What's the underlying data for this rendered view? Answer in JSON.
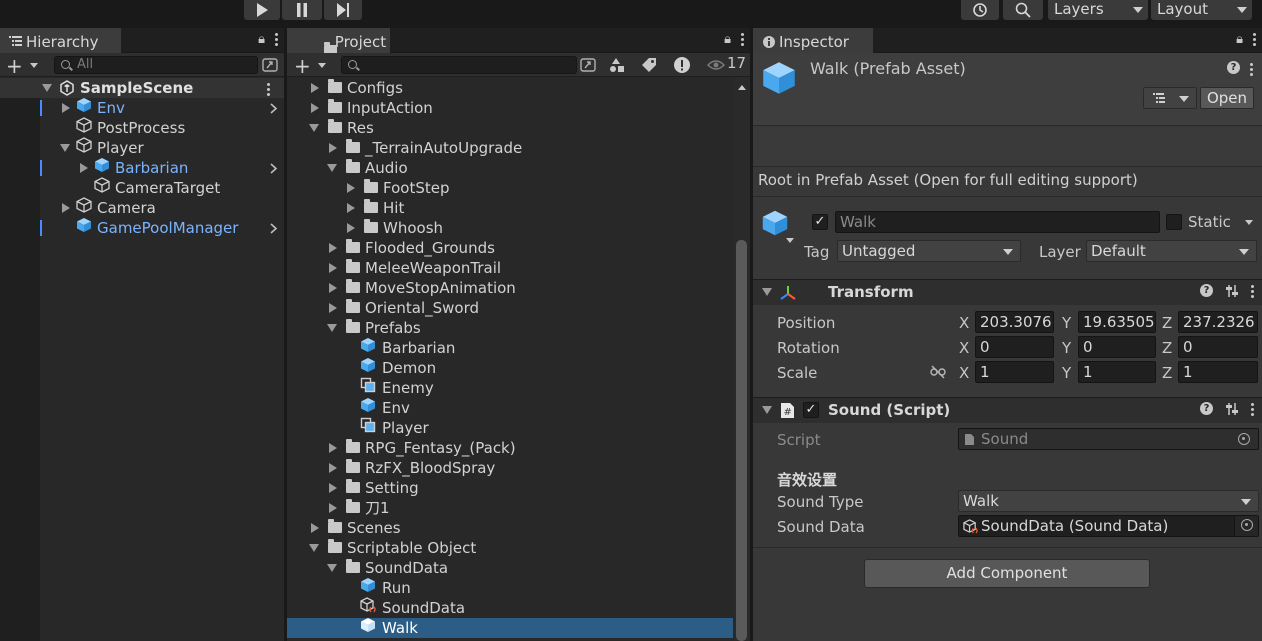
{
  "toolbar": {
    "play_icon": "play-icon",
    "pause_icon": "pause-icon",
    "step_icon": "step-icon",
    "history_icon": "history-icon",
    "search_icon": "search-icon",
    "layers_label": "Layers",
    "layout_label": "Layout"
  },
  "hierarchy": {
    "tab_label": "Hierarchy",
    "search_placeholder": "All",
    "scene_name": "SampleScene",
    "items": [
      {
        "label": "Env",
        "prefab": true
      },
      {
        "label": "PostProcess",
        "prefab": false
      },
      {
        "label": "Player",
        "prefab": false
      },
      {
        "label": "Barbarian",
        "prefab": true
      },
      {
        "label": "CameraTarget",
        "prefab": false
      },
      {
        "label": "Camera",
        "prefab": false
      },
      {
        "label": "GamePoolManager",
        "prefab": true
      }
    ]
  },
  "project": {
    "tab_label": "Project",
    "search_placeholder": "",
    "hidden_count": "17",
    "items": [
      {
        "label": "Configs"
      },
      {
        "label": "InputAction"
      },
      {
        "label": "Res"
      },
      {
        "label": "_TerrainAutoUpgrade"
      },
      {
        "label": "Audio"
      },
      {
        "label": "FootStep"
      },
      {
        "label": "Hit"
      },
      {
        "label": "Whoosh"
      },
      {
        "label": "Flooded_Grounds"
      },
      {
        "label": "MeleeWeaponTrail"
      },
      {
        "label": "MoveStopAnimation"
      },
      {
        "label": "Oriental_Sword"
      },
      {
        "label": "Prefabs"
      },
      {
        "label": "Barbarian"
      },
      {
        "label": "Demon"
      },
      {
        "label": "Enemy"
      },
      {
        "label": "Env"
      },
      {
        "label": "Player"
      },
      {
        "label": "RPG_Fentasy_(Pack)"
      },
      {
        "label": "RzFX_BloodSpray"
      },
      {
        "label": "Setting"
      },
      {
        "label": "刀1"
      },
      {
        "label": "Scenes"
      },
      {
        "label": "Scriptable Object"
      },
      {
        "label": "SoundData"
      },
      {
        "label": "Run"
      },
      {
        "label": "SoundData"
      },
      {
        "label": "Walk"
      }
    ]
  },
  "inspector": {
    "tab_label": "Inspector",
    "asset_title": "Walk (Prefab Asset)",
    "open_label": "Open",
    "root_note": "Root in Prefab Asset (Open for full editing support)",
    "object_name": "Walk",
    "static_label": "Static",
    "tag_label": "Tag",
    "tag_value": "Untagged",
    "layer_label": "Layer",
    "layer_value": "Default",
    "transform": {
      "title": "Transform",
      "position_label": "Position",
      "rotation_label": "Rotation",
      "scale_label": "Scale",
      "axis_x": "X",
      "axis_y": "Y",
      "axis_z": "Z",
      "position": {
        "x": "203.3076",
        "y": "19.63505",
        "z": "237.2326"
      },
      "rotation": {
        "x": "0",
        "y": "0",
        "z": "0"
      },
      "scale": {
        "x": "1",
        "y": "1",
        "z": "1"
      }
    },
    "sound": {
      "title": "Sound (Script)",
      "script_label": "Script",
      "script_value": "Sound",
      "section_header": "音效设置",
      "sound_type_label": "Sound Type",
      "sound_type_value": "Walk",
      "sound_data_label": "Sound Data",
      "sound_data_value": "SoundData (Sound Data)"
    },
    "add_component_label": "Add Component"
  }
}
